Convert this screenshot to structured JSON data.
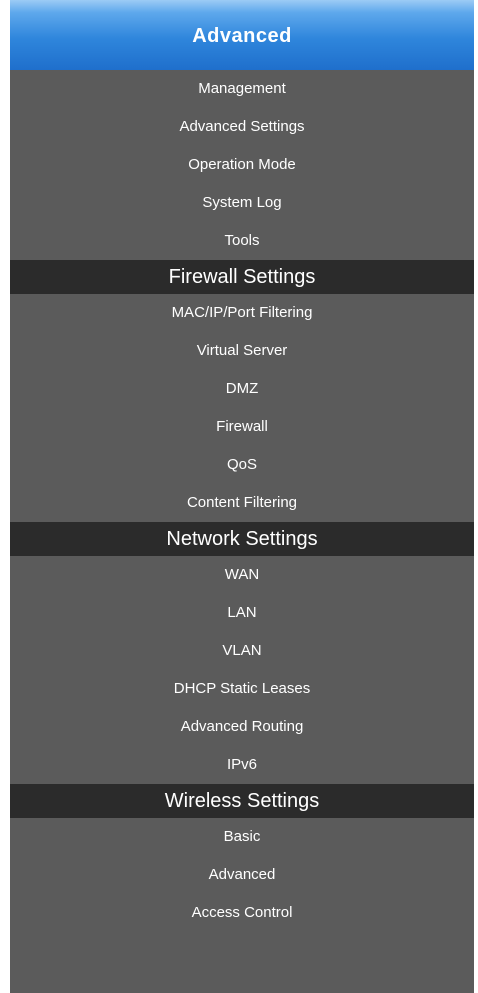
{
  "menu": {
    "header_label": "Advanced",
    "advanced_items": [
      {
        "label": "Management"
      },
      {
        "label": "Advanced Settings"
      },
      {
        "label": "Operation Mode"
      },
      {
        "label": "System Log"
      },
      {
        "label": "Tools"
      }
    ],
    "firewall": {
      "label": "Firewall Settings",
      "items": [
        {
          "label": "MAC/IP/Port Filtering"
        },
        {
          "label": "Virtual Server"
        },
        {
          "label": "DMZ"
        },
        {
          "label": "Firewall"
        },
        {
          "label": "QoS"
        },
        {
          "label": "Content Filtering"
        }
      ]
    },
    "network": {
      "label": "Network Settings",
      "items": [
        {
          "label": "WAN"
        },
        {
          "label": "LAN"
        },
        {
          "label": "VLAN"
        },
        {
          "label": "DHCP Static Leases"
        },
        {
          "label": "Advanced Routing"
        },
        {
          "label": "IPv6"
        }
      ]
    },
    "wireless": {
      "label": "Wireless Settings",
      "items": [
        {
          "label": "Basic"
        },
        {
          "label": "Advanced"
        },
        {
          "label": "Access Control"
        }
      ]
    }
  }
}
